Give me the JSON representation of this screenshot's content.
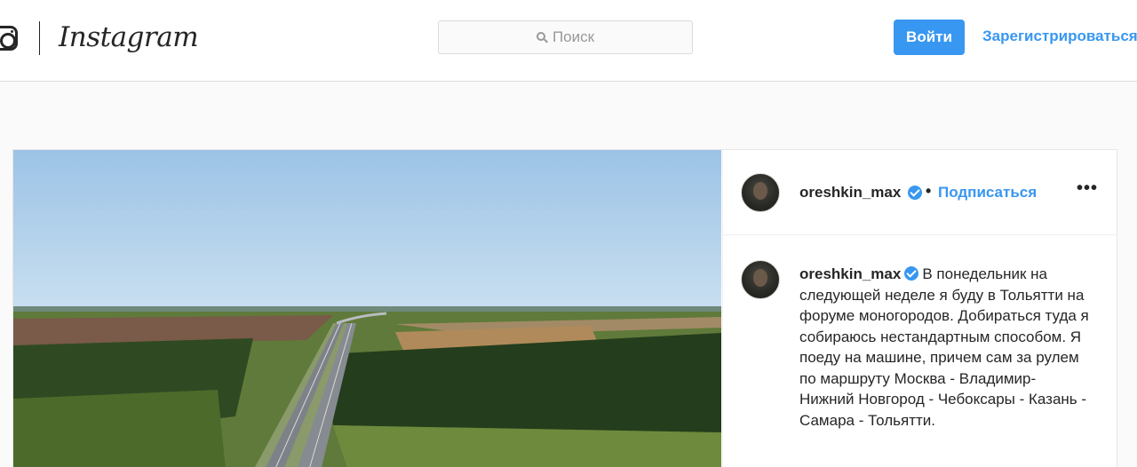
{
  "header": {
    "logo_text": "Instagram",
    "search": {
      "placeholder": "Поиск"
    },
    "login_label": "Войти",
    "signup_label": "Зарегистрироваться"
  },
  "post": {
    "username": "oreshkin_max",
    "separator": "•",
    "follow_label": "Подписаться",
    "more_label": "•••",
    "caption_user": "oreshkin_max",
    "caption_text": "В понедельник на следующей неделе я буду в Тольятти на форуме моногородов. Добираться туда я собираюсь нестандартным способом. Я поеду на машине, причем сам за рулем по маршруту Москва - Владимир- Нижний Новгород - Чебоксары - Казань - Самара - Тольятти."
  },
  "colors": {
    "accent": "#3897f0",
    "text": "#262626",
    "border": "#dbdbdb",
    "background": "#fafafa"
  },
  "icons": [
    "instagram-camera-icon",
    "search-icon",
    "verified-badge-icon",
    "more-options-icon"
  ]
}
